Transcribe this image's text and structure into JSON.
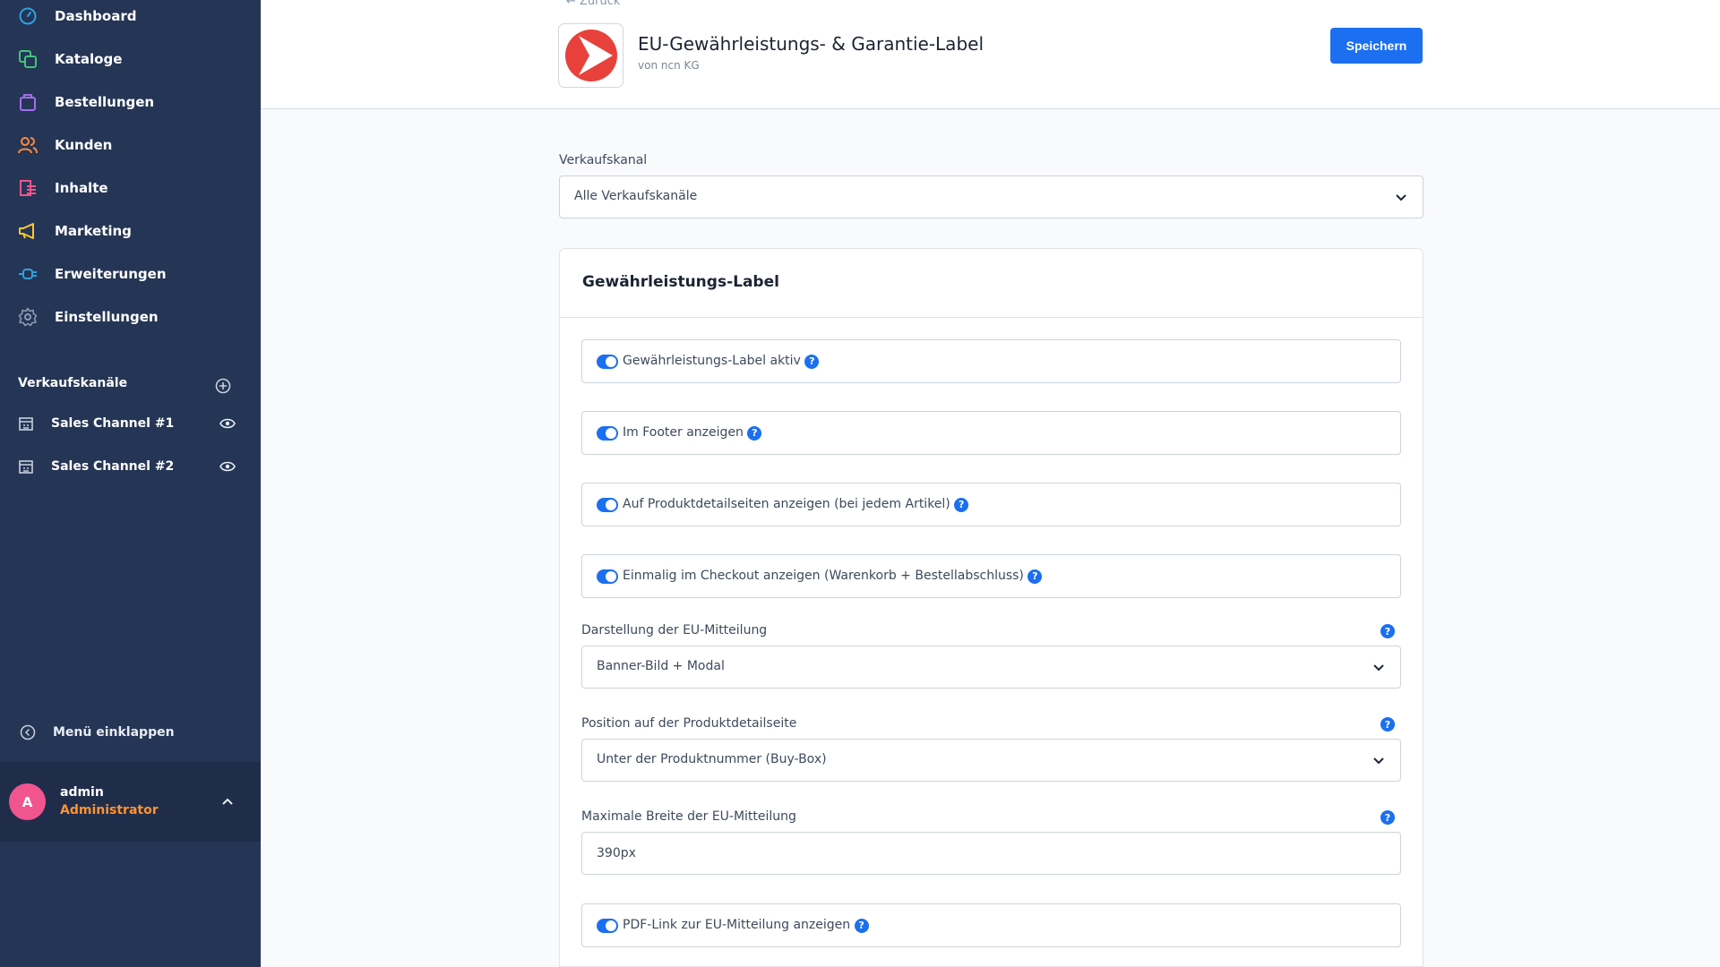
{
  "sidebar": {
    "nav": [
      {
        "label": "Dashboard",
        "icon": "dashboard-icon",
        "color": "#2ea2de"
      },
      {
        "label": "Kataloge",
        "icon": "catalog-icon",
        "color": "#40c47e"
      },
      {
        "label": "Bestellungen",
        "icon": "shopping-bag-icon",
        "color": "#a36cf2"
      },
      {
        "label": "Kunden",
        "icon": "users-icon",
        "color": "#ff8a3d"
      },
      {
        "label": "Inhalte",
        "icon": "content-icon",
        "color": "#f0558e"
      },
      {
        "label": "Marketing",
        "icon": "megaphone-icon",
        "color": "#ffc730"
      },
      {
        "label": "Erweiterungen",
        "icon": "plug-icon",
        "color": "#2ea2de"
      },
      {
        "label": "Einstellungen",
        "icon": "gear-icon",
        "color": "#8f9bb0"
      }
    ],
    "sales_channels_title": "Verkaufskanäle",
    "sales_channels": [
      {
        "label": "Sales Channel #1"
      },
      {
        "label": "Sales Channel #2"
      }
    ],
    "collapse_label": "Menü einklappen",
    "user": {
      "initial": "A",
      "name": "admin",
      "role": "Administrator"
    }
  },
  "header": {
    "back_label": "← Zurück",
    "app_title": "EU-Gewährleistungs- & Garantie-Label",
    "app_vendor": "von ncn KG",
    "save_label": "Speichern"
  },
  "main": {
    "sales_channel_label": "Verkaufskanal",
    "sales_channel_value": "Alle Verkaufskanäle",
    "card_title": "Gewährleistungs-Label",
    "toggles": [
      {
        "label": "Gewährleistungs-Label aktiv",
        "on": true
      },
      {
        "label": "Im Footer anzeigen",
        "on": true
      },
      {
        "label": "Auf Produktdetailseiten anzeigen (bei jedem Artikel)",
        "on": true
      },
      {
        "label": "Einmalig im Checkout anzeigen (Warenkorb + Bestellabschluss)",
        "on": true
      }
    ],
    "display_label": "Darstellung der EU-Mitteilung",
    "display_value": "Banner-Bild + Modal",
    "position_label": "Position auf der Produktdetailseite",
    "position_value": "Unter der Produktnummer (Buy-Box)",
    "maxwidth_label": "Maximale Breite der EU-Mitteilung",
    "maxwidth_value": "390px",
    "pdf_toggle": {
      "label": "PDF-Link zur EU-Mitteilung anzeigen",
      "on": true
    },
    "help_glyph": "?"
  },
  "colors": {
    "sidebar_bg": "#253555",
    "accent": "#1b6ff0",
    "role": "#ff9330",
    "logo_red": "#e8413c"
  }
}
